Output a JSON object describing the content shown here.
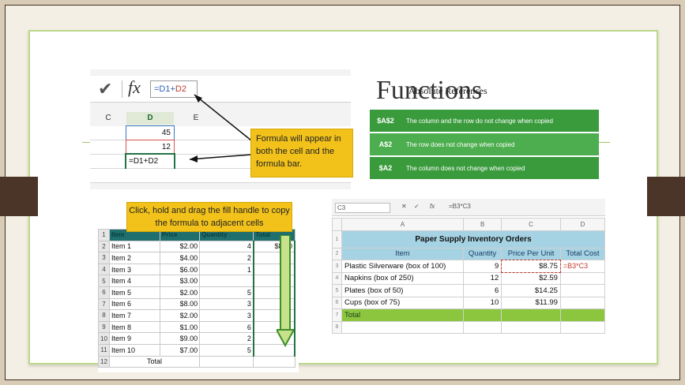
{
  "slide": {
    "title": "Functions",
    "subtitle": "Absolute References"
  },
  "formula_snippet": {
    "check_glyph": "✔",
    "fx_label": "fx",
    "formula_part1": "=D1+",
    "formula_part2": "D2",
    "col_c": "C",
    "col_d": "D",
    "col_e": "E",
    "values": [
      "45",
      "12"
    ],
    "formula_cell": "=D1+D2",
    "callout": "Formula will appear in both the cell and the formula bar."
  },
  "references": [
    {
      "key": "$A$2",
      "desc": "The column and the row do not change when copied"
    },
    {
      "key": "A$2",
      "desc": "The row does not change when copied"
    },
    {
      "key": "$A2",
      "desc": "The column does not change when copied"
    }
  ],
  "fill_sheet": {
    "callout": "Click, hold and drag the fill handle to copy the formula to adjacent cells",
    "headers": [
      "Item",
      "Price",
      "Quantity",
      "Total"
    ],
    "rows": [
      {
        "n": "2",
        "item": "Item 1",
        "price": "$2.00",
        "qty": "4",
        "total": "$8.00"
      },
      {
        "n": "3",
        "item": "Item 2",
        "price": "$4.00",
        "qty": "2",
        "total": ""
      },
      {
        "n": "4",
        "item": "Item 3",
        "price": "$6.00",
        "qty": "1",
        "total": ""
      },
      {
        "n": "5",
        "item": "Item 4",
        "price": "$3.00",
        "qty": "",
        "total": ""
      },
      {
        "n": "6",
        "item": "Item 5",
        "price": "$2.00",
        "qty": "5",
        "total": ""
      },
      {
        "n": "7",
        "item": "Item 6",
        "price": "$8.00",
        "qty": "3",
        "total": ""
      },
      {
        "n": "8",
        "item": "Item 7",
        "price": "$2.00",
        "qty": "3",
        "total": ""
      },
      {
        "n": "9",
        "item": "Item 8",
        "price": "$1.00",
        "qty": "6",
        "total": ""
      },
      {
        "n": "10",
        "item": "Item 9",
        "price": "$9.00",
        "qty": "2",
        "total": ""
      },
      {
        "n": "11",
        "item": "Item 10",
        "price": "$7.00",
        "qty": "5",
        "total": ""
      }
    ],
    "total_row_n": "12",
    "total_label": "Total"
  },
  "inventory": {
    "name_box": "C3",
    "fx": "fx",
    "formula": "=B3*C3",
    "cols": [
      "A",
      "B",
      "C",
      "D"
    ],
    "title": "Paper Supply Inventory Orders",
    "headers": [
      "Item",
      "Quantity",
      "Price Per Unit",
      "Total Cost"
    ],
    "rows": [
      {
        "n": "3",
        "item": "Plastic Silverware (box of 100)",
        "qty": "9",
        "price": "$8.75",
        "total": "=B3*C3"
      },
      {
        "n": "4",
        "item": "Napkins (box of 250)",
        "qty": "12",
        "price": "$2.59",
        "total": ""
      },
      {
        "n": "5",
        "item": "Plates (box of 50)",
        "qty": "6",
        "price": "$14.25",
        "total": ""
      },
      {
        "n": "6",
        "item": "Cups (box of 75)",
        "qty": "10",
        "price": "$11.99",
        "total": ""
      }
    ],
    "total_label": "Total"
  }
}
